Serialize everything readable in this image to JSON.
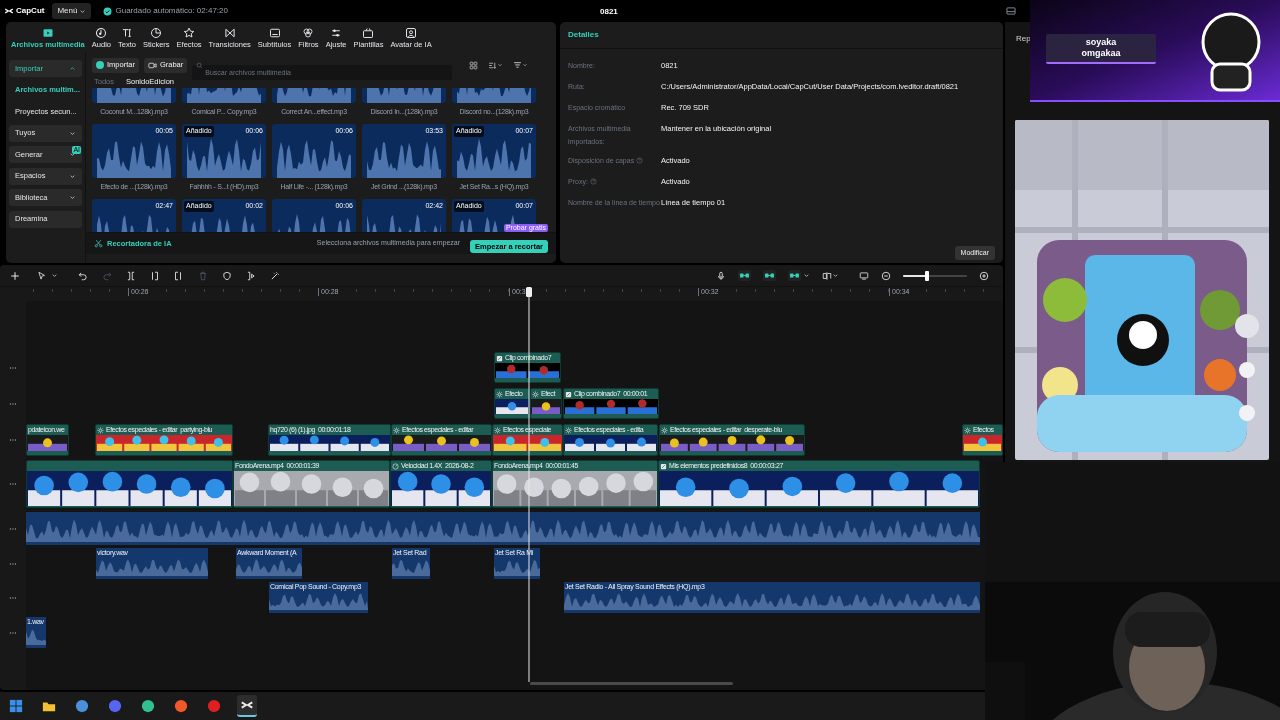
{
  "topbar": {
    "logo": "CapCut",
    "menu": "Menú",
    "autosave": "Guardado automático: 02:47:20",
    "title": "0821"
  },
  "tabs": [
    {
      "label": "Archivos multimedia",
      "selected": true
    },
    {
      "label": "Audio",
      "selected": false
    },
    {
      "label": "Texto",
      "selected": false
    },
    {
      "label": "Stickers",
      "selected": false
    },
    {
      "label": "Efectos",
      "selected": false
    },
    {
      "label": "Transiciones",
      "selected": false
    },
    {
      "label": "Subtítulos",
      "selected": false
    },
    {
      "label": "Filtros",
      "selected": false
    },
    {
      "label": "Ajuste",
      "selected": false
    },
    {
      "label": "Plantillas",
      "selected": false
    },
    {
      "label": "Avatar de IA",
      "selected": false
    }
  ],
  "sidebar": [
    {
      "kind": "section",
      "label": "Importar",
      "expanded": true
    },
    {
      "kind": "link",
      "label": "Archivos multim...",
      "selected": true
    },
    {
      "kind": "link",
      "label": "Proyectos secun...",
      "selected": false
    },
    {
      "kind": "section",
      "label": "Tuyos",
      "expanded": false
    },
    {
      "kind": "section",
      "label": "Generar",
      "expanded": false,
      "badge": "AI"
    },
    {
      "kind": "section",
      "label": "Espacios",
      "expanded": false
    },
    {
      "kind": "section",
      "label": "Biblioteca",
      "expanded": false
    },
    {
      "kind": "button",
      "label": "Dreamina"
    }
  ],
  "media": {
    "import_button": "Importar",
    "record_button": "Grabar",
    "search_placeholder": "Buscar archivos multimedia",
    "breadcrumb": [
      {
        "label": "Todos",
        "selected": false
      },
      {
        "label": "SonidoEdicion",
        "selected": true
      }
    ],
    "items": [
      {
        "name": "Coconut M...128k).mp3"
      },
      {
        "name": "Comical P... Copy.mp3"
      },
      {
        "name": "Correct An...effect.mp3"
      },
      {
        "name": "Discord In...(128k).mp3"
      },
      {
        "name": "Discord no...(128k).mp3"
      },
      {
        "name": "Efecto de ...(128k).mp3",
        "duration": "00:05"
      },
      {
        "name": "Fahhhh - S...t (HD).mp3",
        "duration": "00:06",
        "badge": "Añadido"
      },
      {
        "name": "Half Life -... (128k).mp3",
        "duration": "00:06"
      },
      {
        "name": "Jet Grind ...(128k).mp3",
        "duration": "03:53"
      },
      {
        "name": "Jet Set Ra...s (HQ).mp3",
        "duration": "00:07",
        "badge": "Añadido"
      },
      {
        "duration": "02:47"
      },
      {
        "duration": "00:02",
        "badge": "Añadido"
      },
      {
        "duration": "00:06"
      },
      {
        "duration": "02:42"
      },
      {
        "duration": "00:07",
        "badge": "Añadido"
      }
    ]
  },
  "ai_cutter": {
    "label": "Recortadora de IA",
    "hint": "Selecciona archivos multimedia para empezar",
    "button": "Empezar a recortar",
    "badge": "Probar gratis"
  },
  "details": {
    "title": "Detalles",
    "fields": [
      {
        "label": "Nombre:",
        "value": "0821",
        "help": false
      },
      {
        "label": "Ruta:",
        "value": "C:/Users/Administrator/AppData/Local/CapCut/User Data/Projects/com.lveditor.draft/0821",
        "help": false
      },
      {
        "label": "Espacio cromático",
        "value": "Rec. 709 SDR",
        "help": false
      },
      {
        "label": "Archivos multimedia importados:",
        "value": "Mantener en la ubicación original",
        "help": false
      },
      {
        "label": "Disposición de capas",
        "value": "Activado",
        "help": true
      },
      {
        "label": "Proxy:",
        "value": "Activado",
        "help": true
      },
      {
        "label": "Nombre de la línea de tiempo",
        "value": "Línea de tiempo 01",
        "help": false
      }
    ],
    "button": "Modificar"
  },
  "player": {
    "tab": "Rep"
  },
  "stream_overlay": {
    "lines": [
      "soyaka",
      "omgakaa"
    ]
  },
  "timeline": {
    "tools": [
      {
        "disabled": false
      },
      {
        "disabled": false
      },
      {
        "disabled": false
      },
      {
        "disabled": true
      },
      {
        "disabled": false
      },
      {
        "disabled": false
      },
      {
        "disabled": false
      },
      {
        "disabled": true
      },
      {
        "disabled": false
      },
      {
        "disabled": false
      },
      {
        "disabled": false
      }
    ],
    "toggles": [
      {
        "on": true
      },
      {
        "on": true
      },
      {
        "on": true
      }
    ],
    "zoom": {
      "level": 0.37
    },
    "ruler": [
      "00:26",
      "00:28",
      "00:3",
      "00:32",
      "00:34"
    ],
    "tracks": [
      {
        "clips": [
          {
            "kind": "compound",
            "label": "Clip combinado7"
          }
        ]
      },
      {
        "clips": [
          {
            "kind": "effect",
            "label": "Efecto"
          },
          {
            "kind": "effect",
            "label": "Efect"
          },
          {
            "kind": "compound",
            "label": "Clip combinado7",
            "detail": "00:00:01"
          }
        ]
      },
      {
        "clips": [
          {
            "kind": "media",
            "label": "pdateicon.we"
          },
          {
            "kind": "effect",
            "label": "Efectos especiales - editar",
            "detail": "partying-blu"
          },
          {
            "kind": "media",
            "label": "hq720 (6) (1).jpg",
            "detail": "00:00:01:18"
          },
          {
            "kind": "effect",
            "label": "Efectos especiales - editar"
          },
          {
            "kind": "effect",
            "label": "Efectos especiale"
          },
          {
            "kind": "effect",
            "label": "Efectos especiales - edita"
          },
          {
            "kind": "effect",
            "label": "Efectos especiales - editar",
            "detail": "desperate-blu"
          },
          {
            "kind": "effect",
            "label": "Efectos"
          }
        ]
      },
      {
        "clips": [
          {
            "kind": "media"
          },
          {
            "kind": "media",
            "label": "FondoArena.mp4",
            "detail": "00:00:01:39"
          },
          {
            "kind": "speed",
            "label": "Velocidad 1.4X",
            "detail": "2026-08-2"
          },
          {
            "kind": "media",
            "label": "FondoArena.mp4",
            "detail": "00:00:01:45"
          },
          {
            "kind": "compound",
            "label": "Mis elementos predefinidos8",
            "detail": "00:00:03:27"
          }
        ]
      },
      {
        "clips": [
          {
            "kind": "audio"
          }
        ]
      },
      {
        "clips": [
          {
            "kind": "audio",
            "label": "victory.wav"
          },
          {
            "kind": "audio",
            "label": "Awkward Moment (A"
          },
          {
            "kind": "audio",
            "label": "Jet Set Rad"
          },
          {
            "kind": "audio",
            "label": "Jet Set Ra Mi"
          }
        ]
      },
      {
        "clips": [
          {
            "kind": "audio",
            "label": "Comical Pop Sound - Copy.mp3"
          },
          {
            "kind": "audio",
            "label": "Jet Set Radio - All Spray Sound Effects (HQ).mp3"
          }
        ]
      },
      {
        "clips": [
          {
            "kind": "audio",
            "label": "1.wav"
          }
        ]
      }
    ]
  },
  "taskbar": {
    "apps": [
      {
        "selected": false
      },
      {
        "selected": false
      },
      {
        "selected": false
      },
      {
        "selected": false
      },
      {
        "selected": false
      },
      {
        "selected": false
      },
      {
        "selected": false
      },
      {
        "selected": true
      }
    ]
  }
}
